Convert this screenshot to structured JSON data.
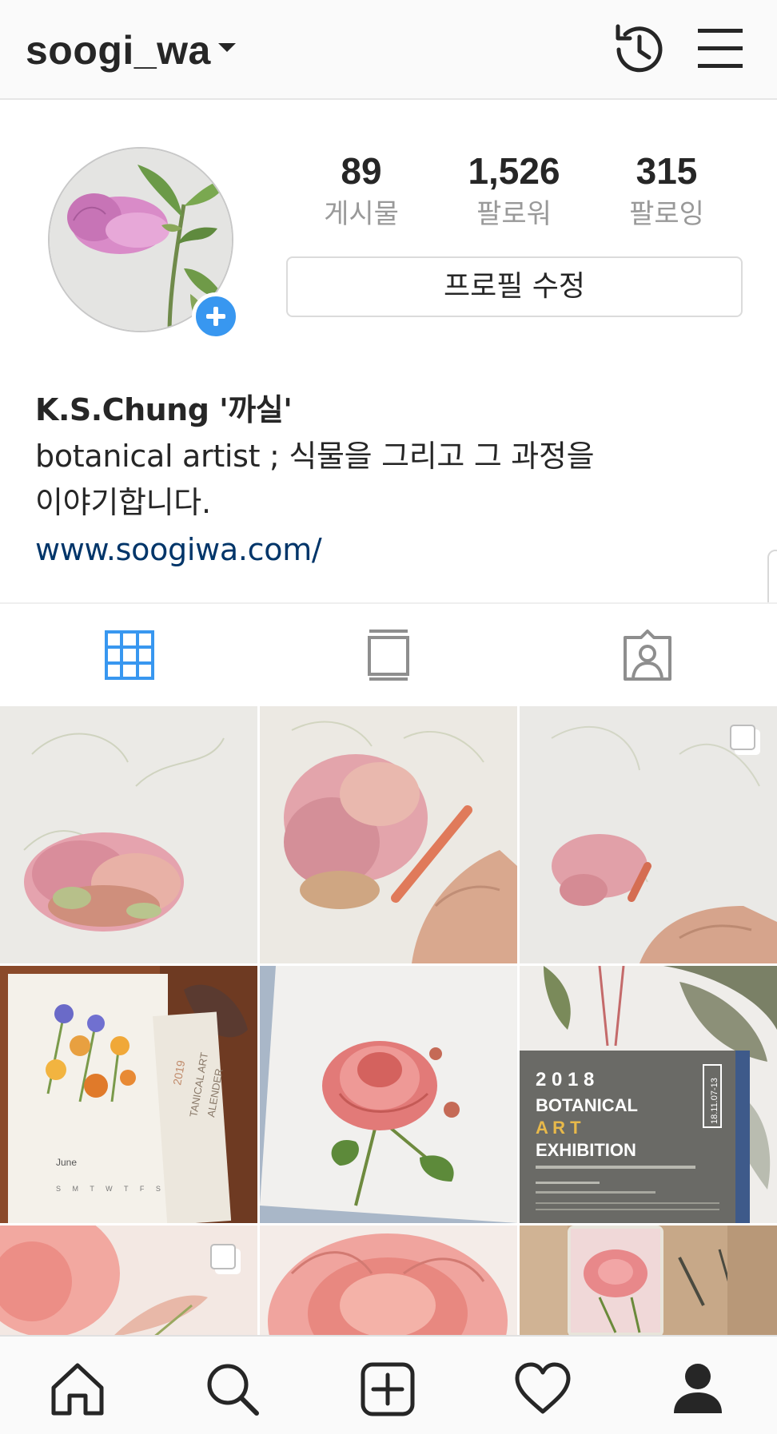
{
  "header": {
    "username": "soogi_wa",
    "icons": [
      "chevron-down-icon",
      "history-icon",
      "menu-icon"
    ]
  },
  "profile": {
    "stats": [
      {
        "value": "89",
        "label": "게시물"
      },
      {
        "value": "1,526",
        "label": "팔로워"
      },
      {
        "value": "315",
        "label": "팔로잉"
      }
    ],
    "edit_button": "프로필 수정",
    "bio_name": "K.S.Chung '까실'",
    "bio_text": "botanical artist ; 식물을 그리고 그 과정을 이야기합니다.",
    "bio_link": "www.soogiwa.com/"
  },
  "tabs": [
    "grid-icon",
    "feed-icon",
    "tagged-icon"
  ],
  "grid": {
    "posts": [
      {
        "subject": "hydrangea drawing",
        "multiple": false
      },
      {
        "subject": "hydrangea drawing in progress",
        "multiple": false
      },
      {
        "subject": "hydrangea sketch with pencil",
        "multiple": true
      },
      {
        "subject": "botanical art calendar",
        "multiple": false
      },
      {
        "subject": "rose illustration",
        "multiple": false
      },
      {
        "subject": "exhibition poster",
        "multiple": false
      },
      {
        "subject": "rose detail",
        "multiple": true
      },
      {
        "subject": "rose close-up",
        "multiple": false
      },
      {
        "subject": "rose on phone",
        "multiple": false
      }
    ],
    "poster_text": {
      "year": "2 0 1 8",
      "line1": "BOTANICAL",
      "line2": "A R T",
      "line3": "EXHIBITION",
      "dates": "18.11.07-13"
    },
    "calendar_text": {
      "title_year": "2019",
      "title1": "TANICAL ART",
      "title2": "ALENDER",
      "month": "June",
      "weekdays": "S M T W T F S"
    }
  },
  "bottom_nav": [
    "home-icon",
    "search-icon",
    "add-post-icon",
    "activity-heart-icon",
    "profile-icon"
  ],
  "colors": {
    "accent_blue": "#3897f0",
    "link_blue": "#003569",
    "text": "#262626",
    "muted": "#999999"
  }
}
